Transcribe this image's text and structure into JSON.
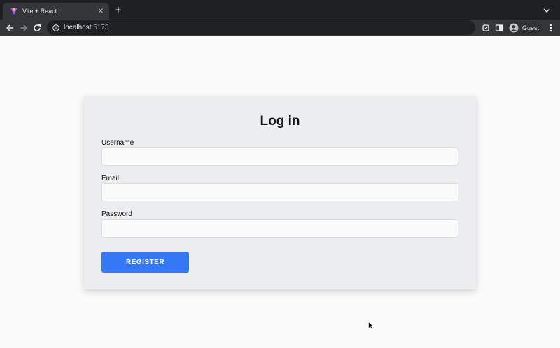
{
  "browser": {
    "tab_title": "Vite + React",
    "close_glyph": "✕",
    "newtab_glyph": "+",
    "url_host": "localhost",
    "url_port": ":5173",
    "profile_name": "Guest"
  },
  "form": {
    "heading": "Log in",
    "username_label": "Username",
    "email_label": "Email",
    "password_label": "Password",
    "submit_label": "REGISTER",
    "username_value": "",
    "email_value": "",
    "password_value": ""
  },
  "colors": {
    "button": "#3478f6",
    "card": "#ecedef",
    "chrome_dark": "#1f2023",
    "chrome_toolbar": "#35363a"
  },
  "icons": [
    "vite-favicon-icon",
    "close-icon",
    "plus-icon",
    "chevron-down-icon",
    "back-arrow-icon",
    "forward-arrow-icon",
    "reload-icon",
    "info-icon",
    "extensions-icon",
    "side-panel-icon",
    "profile-avatar-icon",
    "kebab-menu-icon",
    "mouse-cursor-icon"
  ]
}
